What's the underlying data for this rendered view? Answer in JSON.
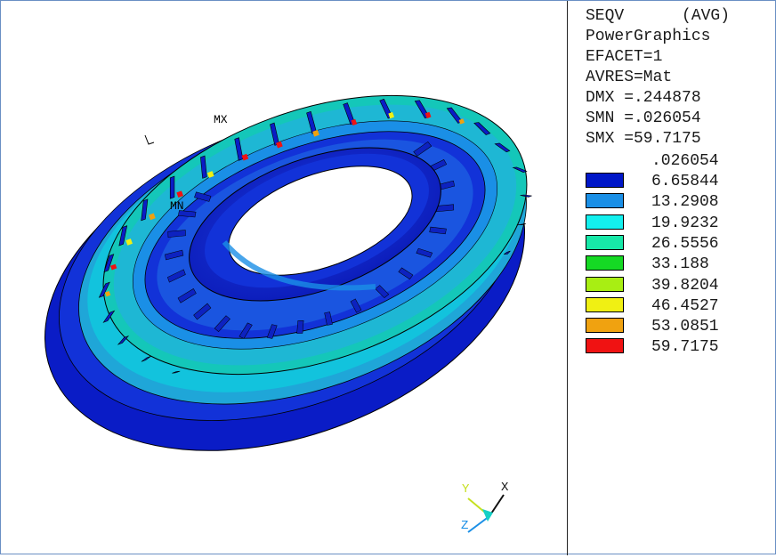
{
  "legend": {
    "header": [
      "SEQV      (AVG)",
      "PowerGraphics",
      "EFACET=1",
      "AVRES=Mat",
      "DMX =.244878",
      "SMN =.026054",
      "SMX =59.7175"
    ],
    "min_value": ".026054",
    "levels": [
      {
        "value": "6.65844",
        "color": "#0017c8"
      },
      {
        "value": "13.2908",
        "color": "#1a8fe6"
      },
      {
        "value": "19.9232",
        "color": "#13f0ee"
      },
      {
        "value": "26.5556",
        "color": "#17e8a8"
      },
      {
        "value": "33.188",
        "color": "#15d924"
      },
      {
        "value": "39.8204",
        "color": "#a8ee13"
      },
      {
        "value": "46.4527",
        "color": "#f0f013"
      },
      {
        "value": "53.0851",
        "color": "#f0a210"
      },
      {
        "value": "59.7175",
        "color": "#f01212"
      }
    ]
  },
  "model": {
    "mx_label": "MX",
    "mn_label": "MN"
  },
  "triad": {
    "x_label": "X",
    "y_label": "Y",
    "z_label": "Z"
  }
}
